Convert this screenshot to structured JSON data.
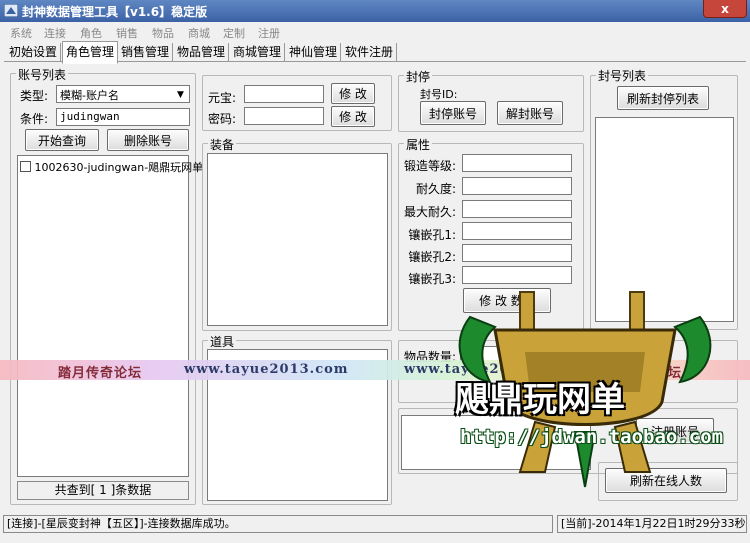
{
  "window": {
    "title": "封神数据管理工具【v1.6】稳定版",
    "close_label": "x"
  },
  "menu": [
    "系统",
    "连接",
    "角色",
    "销售",
    "物品",
    "商城",
    "定制",
    "注册"
  ],
  "tabs": [
    "初始设置",
    "角色管理",
    "销售管理",
    "物品管理",
    "商城管理",
    "神仙管理",
    "软件注册"
  ],
  "account_list": {
    "title": "账号列表",
    "type_label": "类型:",
    "type_value": "模糊-账户名",
    "cond_label": "条件:",
    "cond_value": "judingwan",
    "query_button": "开始查询",
    "delete_button": "删除账号",
    "items": [
      "1002630-judingwan-飓鼎玩网单"
    ],
    "count_text": "共查到[ 1 ]条数据"
  },
  "currency": {
    "yuanbao_label": "元宝:",
    "password_label": "密码:",
    "modify_label": "修 改"
  },
  "equipment": {
    "title": "装备"
  },
  "props": {
    "title": "道具"
  },
  "ban": {
    "title": "封停",
    "id_label": "封号ID:",
    "ban_button": "封停账号",
    "unban_button": "解封账号"
  },
  "attributes": {
    "title": "属性",
    "labels": [
      "锻造等级:",
      "耐久度:",
      "最大耐久:",
      "镶嵌孔1:",
      "镶嵌孔2:",
      "镶嵌孔3:"
    ],
    "modify_button": "修 改 数据"
  },
  "banned_list": {
    "title": "封号列表",
    "refresh_button": "刷新封停列表"
  },
  "item_count": {
    "label": "物品数量:"
  },
  "register_button": "注册账号",
  "refresh_online_button": "刷新在线人数",
  "status": {
    "left": "[连接]-[星辰变封神【五区】]-连接数据库成功。",
    "right": "[当前]-2014年1月22日1时29分33秒"
  },
  "watermark": {
    "forum_1": "踏月传奇论坛",
    "url_1": "www.tayue2013.com",
    "url_2": "www.tayue2013.cn",
    "forum_2": "踏月传奇论坛",
    "brand": "飓鼎玩网单",
    "brand_url": "http://jdwan.taobao.com"
  },
  "colors": {
    "titlebar": "#3c62a6",
    "close": "#c7463b",
    "watermark_green": "#1e8a2e",
    "watermark_gold": "#c9a23a"
  }
}
